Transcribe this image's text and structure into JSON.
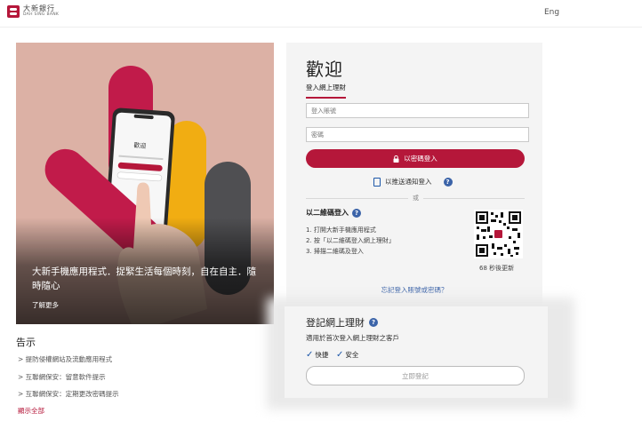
{
  "header": {
    "logo_cn": "大新銀行",
    "logo_en": "DAH SING BANK",
    "lang_label": "Eng"
  },
  "hero": {
    "title": "大新手機應用程式．捉緊生活每個時刻，自在自主．隨時隨心",
    "more_label": "了解更多",
    "phone_welcome": "歡迎"
  },
  "notice": {
    "title": "告示",
    "links": [
      "> 提防侵權網站及流動應用程式",
      "> 互聯網保安：留意軟件提示",
      "> 互聯網保安：定期更改密碼提示"
    ],
    "show_all": "顯示全部"
  },
  "login": {
    "welcome": "歡迎",
    "tab_label": "登入網上理財",
    "username_placeholder": "登入賬號",
    "password_placeholder": "密碼",
    "login_button": "以密碼登入",
    "push_label": "以推送通知登入",
    "or_text": "或",
    "qr_title": "以二維碼登入",
    "qr_steps": [
      "1. 打開大新手機應用程式",
      "2. 按「以二維碼登入網上理財」",
      "3. 掃描二維碼及登入"
    ],
    "qr_refresh": "68 秒後更新",
    "forgot_link": "忘記登入賬號或密碼？"
  },
  "register": {
    "title": "登記網上理財",
    "subtitle": "適用於首次登入網上理財之客戶",
    "feature_fast": "快捷",
    "feature_safe": "安全",
    "button": "立即登記"
  },
  "colors": {
    "brand": "#b5173a",
    "link_blue": "#3b63a8",
    "panel_bg": "#f4f4f4"
  }
}
